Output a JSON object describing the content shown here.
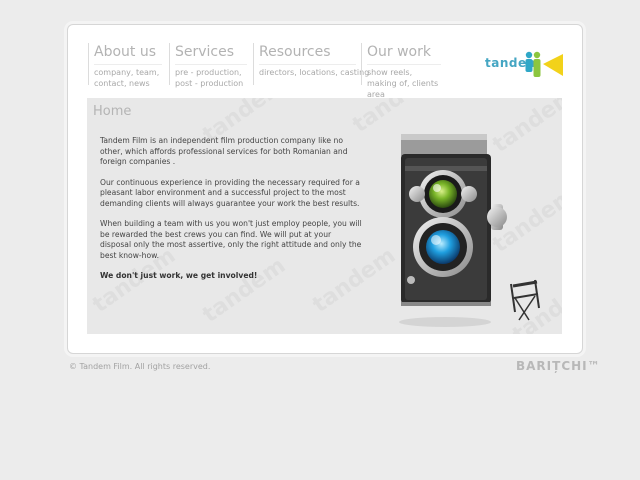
{
  "nav": {
    "items": [
      {
        "title": "About us",
        "subtitle": "company, team, contact, news"
      },
      {
        "title": "Services",
        "subtitle": "pre - production, post - production"
      },
      {
        "title": "Resources",
        "subtitle": "directors, locations, casting"
      },
      {
        "title": "Our work",
        "subtitle": "show reels, making of, clients area"
      }
    ]
  },
  "logo": {
    "text": "tandem"
  },
  "main": {
    "title": "Home",
    "paragraphs": [
      "Tandem Film is an independent film production company like no other, which affords professional services for both Romanian and foreign companies .",
      "Our continuous experience in providing the necessary required for a pleasant labor environment and a successful project to the most demanding clients will always guarantee your work the best results.",
      "When building a team with us you won't just employ people, you will be rewarded the best crews you can find. We will put at your disposal only the most assertive, only the right attitude and only the best know-how."
    ],
    "tagline": "We don't just work, we get involved!",
    "watermark": "tandem"
  },
  "footer": {
    "copyright": "© Tandem Film. All rights reserved.",
    "brand": "BARIȚCHI™"
  }
}
